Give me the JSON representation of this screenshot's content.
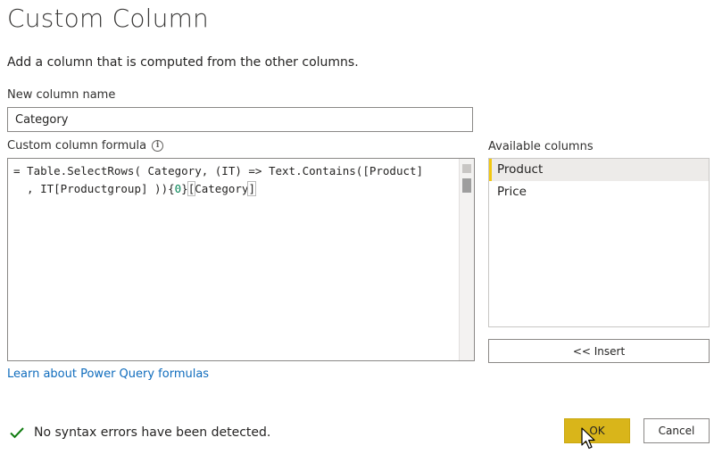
{
  "dialog": {
    "title": "Custom Column",
    "description": "Add a column that is computed from the other columns."
  },
  "new_column": {
    "label": "New column name",
    "value": "Category"
  },
  "formula": {
    "label": "Custom column formula",
    "info_icon": "info-icon",
    "line1_prefix": "= Table.SelectRows( Category, (IT) => Text.Contains([Product]",
    "line2_prefix": "  , IT[Productgroup] )){",
    "line2_index": "0",
    "line2_suffix_open": "}",
    "line2_bracket_open": "[",
    "line2_field": "Category",
    "line2_bracket_close": "]"
  },
  "available_columns": {
    "label": "Available columns",
    "items": [
      {
        "label": "Product",
        "selected": true
      },
      {
        "label": "Price",
        "selected": false
      }
    ],
    "insert_label": "<< Insert"
  },
  "learn_link": "Learn about Power Query formulas",
  "status": {
    "icon": "check-icon",
    "text": "No syntax errors have been detected.",
    "color": "#107c10"
  },
  "buttons": {
    "ok_label": "OK",
    "cancel_label": "Cancel",
    "ok_color": "#d9b51a"
  }
}
